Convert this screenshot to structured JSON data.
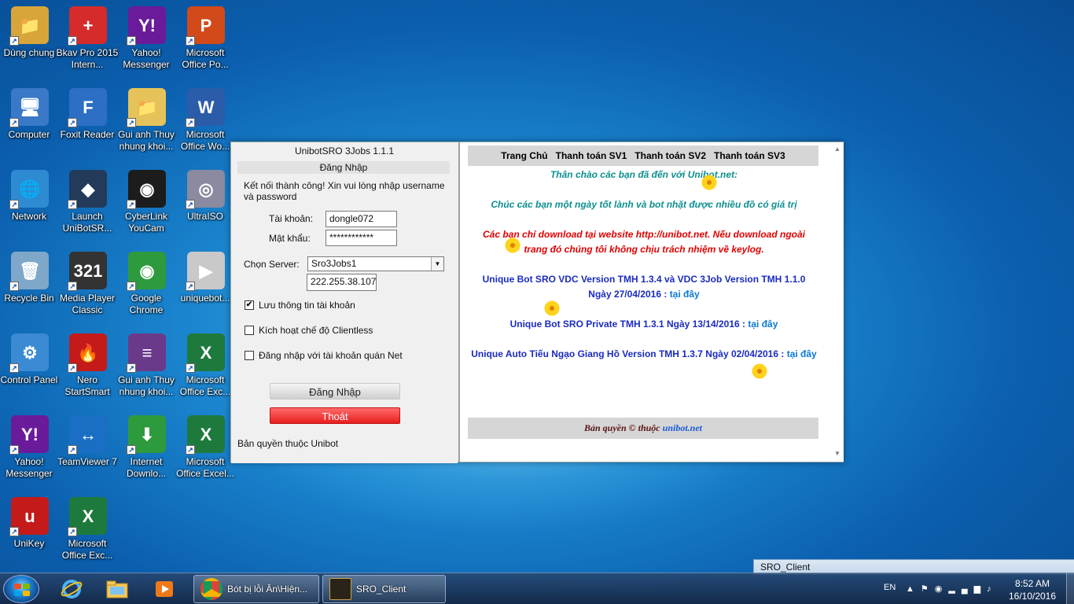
{
  "desktop": {
    "icons": [
      {
        "label": "Dùng chung",
        "icon": "folder-user-icon",
        "color": "#d8a53a",
        "glyph": "📁"
      },
      {
        "label": "Bkav Pro 2015 Intern...",
        "icon": "bkav-icon",
        "color": "#d62b2b",
        "glyph": "+"
      },
      {
        "label": "Yahoo! Messenger",
        "icon": "yahoo-messenger-icon",
        "color": "#6a1b9a",
        "glyph": "Y!"
      },
      {
        "label": "Microsoft Office Po...",
        "icon": "powerpoint-icon",
        "color": "#d24a1a",
        "glyph": "P"
      },
      {
        "label": "Computer",
        "icon": "computer-icon",
        "color": "#3a78c8",
        "glyph": "🖥"
      },
      {
        "label": "Foxit Reader",
        "icon": "foxit-reader-icon",
        "color": "#2c6fc4",
        "glyph": "F"
      },
      {
        "label": "Gui anh Thuy nhung khoi...",
        "icon": "folder-icon",
        "color": "#e5c35a",
        "glyph": "📁"
      },
      {
        "label": "Microsoft Office Wo...",
        "icon": "word-icon",
        "color": "#2a5caa",
        "glyph": "W"
      },
      {
        "label": "Network",
        "icon": "network-icon",
        "color": "#2e8bd1",
        "glyph": "🌐"
      },
      {
        "label": "Launch UniBotSR...",
        "icon": "unibot-icon",
        "color": "#233a5a",
        "glyph": "◆"
      },
      {
        "label": "CyberLink YouCam",
        "icon": "youcam-icon",
        "color": "#1c1c1c",
        "glyph": "◉"
      },
      {
        "label": "UltraISO",
        "icon": "ultraiso-icon",
        "color": "#8a8aa0",
        "glyph": "◎"
      },
      {
        "label": "Recycle Bin",
        "icon": "recycle-bin-icon",
        "color": "#7fa7c9",
        "glyph": "🗑"
      },
      {
        "label": "Media Player Classic",
        "icon": "media-player-icon",
        "color": "#333",
        "glyph": "321"
      },
      {
        "label": "Google Chrome",
        "icon": "chrome-icon",
        "color": "#2e9a3e",
        "glyph": "◉"
      },
      {
        "label": "uniquebot...",
        "icon": "document-icon",
        "color": "#c9c9c9",
        "glyph": "▶"
      },
      {
        "label": "Control Panel",
        "icon": "control-panel-icon",
        "color": "#3a8ad4",
        "glyph": "⚙"
      },
      {
        "label": "Nero StartSmart",
        "icon": "nero-icon",
        "color": "#c41a1a",
        "glyph": "🔥"
      },
      {
        "label": "Gui anh Thuy nhung khoi...",
        "icon": "winrar-icon",
        "color": "#6a3a8a",
        "glyph": "≡"
      },
      {
        "label": "Microsoft Office Exc...",
        "icon": "excel-icon",
        "color": "#1e7a3c",
        "glyph": "X"
      },
      {
        "label": "Yahoo! Messenger",
        "icon": "yahoo-messenger-icon",
        "color": "#6a1b9a",
        "glyph": "Y!"
      },
      {
        "label": "TeamViewer 7",
        "icon": "teamviewer-icon",
        "color": "#1a6fc4",
        "glyph": "↔"
      },
      {
        "label": "Internet Downlo...",
        "icon": "idm-icon",
        "color": "#2e9a3e",
        "glyph": "⬇"
      },
      {
        "label": "Microsoft Office Excel...",
        "icon": "excel-icon",
        "color": "#1e7a3c",
        "glyph": "X"
      },
      {
        "label": "UniKey",
        "icon": "unikey-icon",
        "color": "#c41a1a",
        "glyph": "u"
      },
      {
        "label": "Microsoft Office Exc...",
        "icon": "excel-icon",
        "color": "#1e7a3c",
        "glyph": "X"
      }
    ]
  },
  "login": {
    "title": "UnibotSRO 3Jobs 1.1.1",
    "subtitle": "Đăng Nhập",
    "message": "Kết nối thành công! Xin vui lòng nhập username và password",
    "account_label": "Tài khoản:",
    "account_value": "dongle072",
    "password_label": "Mật khẩu:",
    "password_value": "************",
    "server_label": "Chọn Server:",
    "server_value": "Sro3Jobs1",
    "ip_value": "222.255.38.107",
    "remember_label": "Lưu thông tin tài khoản",
    "remember_checked": "✔",
    "clientless_label": "Kích hoạt chế độ Clientless",
    "netcafe_label": "Đăng nhập với tài khoản quán Net",
    "login_button": "Đăng Nhập",
    "exit_button": "Thoát",
    "copyright": "Bản quyền thuộc Unibot"
  },
  "web": {
    "nav": [
      "Trang Chủ",
      "Thanh toán SV1",
      "Thanh toán SV2",
      "Thanh toán SV3"
    ],
    "welcome": "Thân chào các bạn đã đến với Unibot.net:",
    "wish": "Chúc các bạn một ngày tốt lành và bot nhặt được nhiều đồ có giá trị",
    "warning": "Các bạn chỉ download tại website http://unibot.net. Nếu download ngoài trang đó chúng tôi không chịu trách nhiệm về keylog.",
    "release1": "Unique Bot SRO VDC Version TMH 1.3.4 và VDC 3Job Version TMH 1.1.0 Ngày 27/04/2016 : ",
    "release2": "Unique Bot SRO Private TMH 1.3.1 Ngày 13/14/2016 : ",
    "release3": "Unique Auto Tiếu Ngạo Giang Hồ Version TMH 1.3.7 Ngày 02/04/2016 : ",
    "link_text": "tại đây",
    "footer_prefix": "Bản quyền © thuộc ",
    "footer_link": "unibot.net"
  },
  "sro_client_title": "SRO_Client",
  "taskbar": {
    "tasks": [
      "Bót bị lỗi Ân\\Hiện...",
      "SRO_Client"
    ],
    "lang": "EN",
    "time": "8:52 AM",
    "date": "16/10/2016"
  }
}
